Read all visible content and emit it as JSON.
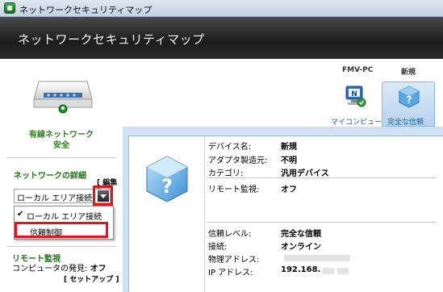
{
  "window": {
    "title": "ネットワークセキュリティマップ"
  },
  "banner": {
    "title": "ネットワークセキュリティマップ"
  },
  "left": {
    "network_label_line1": "有線ネットワーク",
    "network_label_line2": "安全",
    "details_title": "ネットワークの詳細",
    "edit_link": "[ 編集 ]",
    "dropdown_value": "ローカル エリア接続",
    "menu_items": [
      "ローカル エリア接続",
      "信頼制御"
    ],
    "remote_title": "リモート監視",
    "discovery_label": "コンピュータの発見:",
    "discovery_value": "オフ",
    "setup_link": "[ セットアップ ]"
  },
  "map": {
    "pc_name": "FMV-PC",
    "new_label": "新規",
    "my_computer": "マイコンピュータ",
    "fully_trusted": "完全な信頼"
  },
  "details": {
    "rows1": [
      {
        "label": "デバイス名:",
        "value": "新規"
      },
      {
        "label": "アダプタ製造元:",
        "value": "不明"
      },
      {
        "label": "カテゴリ:",
        "value": "汎用デバイス"
      }
    ],
    "remote_label": "リモート監視:",
    "remote_value": "オフ",
    "rows2": [
      {
        "label": "信頼レベル:",
        "value": "完全な信頼"
      },
      {
        "label": "接続:",
        "value": "オンライン"
      },
      {
        "label": "物理アドレス:",
        "value": ""
      },
      {
        "label": "IP アドレス:",
        "value": "192.168."
      }
    ]
  },
  "colors": {
    "highlight": "#e0141e",
    "green_text": "#1f6f16",
    "link_blue": "#1a5fa8"
  }
}
